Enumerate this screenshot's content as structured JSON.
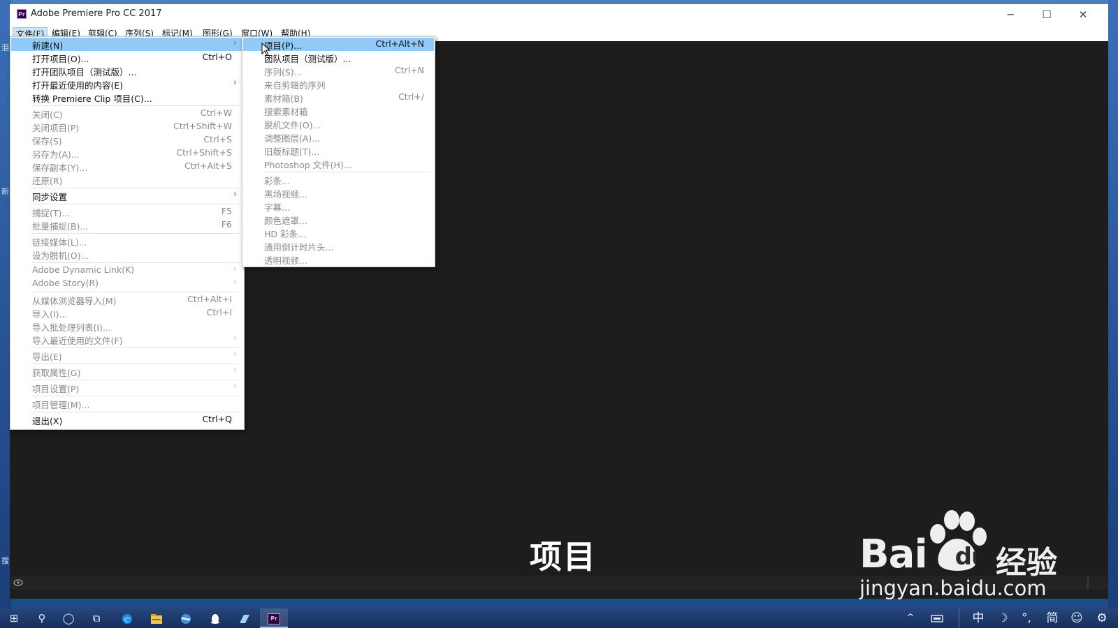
{
  "window": {
    "title": "Adobe Premiere Pro CC 2017",
    "app_icon_text": "Pr",
    "controls": {
      "minimize": "─",
      "maximize": "☐",
      "close": "✕"
    }
  },
  "menubar": [
    {
      "label": "文件(F)",
      "active": true
    },
    {
      "label": "编辑(E)"
    },
    {
      "label": "剪辑(C)"
    },
    {
      "label": "序列(S)"
    },
    {
      "label": "标记(M)"
    },
    {
      "label": "图形(G)"
    },
    {
      "label": "窗口(W)"
    },
    {
      "label": "帮助(H)"
    }
  ],
  "file_menu": [
    {
      "label": "新建(N)",
      "arrow": true,
      "enabled": true,
      "highlighted": true
    },
    {
      "label": "打开项目(O)...",
      "shortcut": "Ctrl+O",
      "enabled": true
    },
    {
      "label": "打开团队项目（测试版）...",
      "enabled": true
    },
    {
      "label": "打开最近使用的内容(E)",
      "arrow": true,
      "enabled": true
    },
    {
      "label": "转换 Premiere Clip 项目(C)...",
      "enabled": true
    },
    {
      "separator": true
    },
    {
      "label": "关闭(C)",
      "shortcut": "Ctrl+W",
      "enabled": false
    },
    {
      "label": "关闭项目(P)",
      "shortcut": "Ctrl+Shift+W",
      "enabled": false
    },
    {
      "label": "保存(S)",
      "shortcut": "Ctrl+S",
      "enabled": false
    },
    {
      "label": "另存为(A)...",
      "shortcut": "Ctrl+Shift+S",
      "enabled": false
    },
    {
      "label": "保存副本(Y)...",
      "shortcut": "Ctrl+Alt+S",
      "enabled": false
    },
    {
      "label": "还原(R)",
      "enabled": false
    },
    {
      "separator": true
    },
    {
      "label": "同步设置",
      "arrow": true,
      "enabled": true
    },
    {
      "separator": true
    },
    {
      "label": "捕捉(T)...",
      "shortcut": "F5",
      "enabled": false
    },
    {
      "label": "批量捕捉(B)...",
      "shortcut": "F6",
      "enabled": false
    },
    {
      "separator": true
    },
    {
      "label": "链接媒体(L)...",
      "enabled": false
    },
    {
      "label": "设为脱机(O)...",
      "enabled": false
    },
    {
      "separator": true
    },
    {
      "label": "Adobe Dynamic Link(K)",
      "arrow": true,
      "enabled": false
    },
    {
      "label": "Adobe Story(R)",
      "arrow": true,
      "enabled": false
    },
    {
      "separator": true
    },
    {
      "label": "从媒体浏览器导入(M)",
      "shortcut": "Ctrl+Alt+I",
      "enabled": false
    },
    {
      "label": "导入(I)...",
      "shortcut": "Ctrl+I",
      "enabled": false
    },
    {
      "label": "导入批处理列表(I)...",
      "enabled": false
    },
    {
      "label": "导入最近使用的文件(F)",
      "arrow": true,
      "enabled": false
    },
    {
      "separator": true
    },
    {
      "label": "导出(E)",
      "arrow": true,
      "enabled": false
    },
    {
      "separator": true
    },
    {
      "label": "获取属性(G)",
      "arrow": true,
      "enabled": false
    },
    {
      "separator": true
    },
    {
      "label": "项目设置(P)",
      "arrow": true,
      "enabled": false
    },
    {
      "separator": true
    },
    {
      "label": "项目管理(M)...",
      "enabled": false
    },
    {
      "separator": true
    },
    {
      "label": "退出(X)",
      "shortcut": "Ctrl+Q",
      "enabled": true
    }
  ],
  "new_submenu": [
    {
      "label": "项目(P)...",
      "shortcut": "Ctrl+Alt+N",
      "enabled": true,
      "highlighted": true
    },
    {
      "label": "团队项目（测试版）...",
      "enabled": true
    },
    {
      "label": "序列(S)...",
      "shortcut": "Ctrl+N",
      "enabled": false
    },
    {
      "label": "来自剪辑的序列",
      "enabled": false
    },
    {
      "label": "素材箱(B)",
      "shortcut": "Ctrl+/",
      "enabled": false
    },
    {
      "label": "搜索素材箱",
      "enabled": false
    },
    {
      "label": "脱机文件(O)...",
      "enabled": false
    },
    {
      "label": "调整图层(A)...",
      "enabled": false
    },
    {
      "label": "旧版标题(T)...",
      "enabled": false
    },
    {
      "label": "Photoshop 文件(H)...",
      "enabled": false
    },
    {
      "separator": true
    },
    {
      "label": "彩条...",
      "enabled": false
    },
    {
      "label": "黑场视频...",
      "enabled": false
    },
    {
      "label": "字幕...",
      "enabled": false
    },
    {
      "label": "颜色遮罩...",
      "enabled": false
    },
    {
      "label": "HD 彩条...",
      "enabled": false
    },
    {
      "label": "通用倒计时片头...",
      "enabled": false
    },
    {
      "label": "透明视频...",
      "enabled": false
    }
  ],
  "caption": "项目",
  "watermark": {
    "brand": "Bai",
    "brand_suffix": "du",
    "chinese": "经验",
    "url": "jingyan.baidu.com"
  },
  "desktop_fragments": [
    "泪",
    "新",
    "搜"
  ],
  "taskbar": {
    "start_icon": "⊞",
    "search_icon": "⚲",
    "cortana_icon": "◯",
    "taskview_icon": "⧉",
    "tray_lang": "中",
    "tray_moon": "☽",
    "tray_punct": "°,",
    "tray_simplified": "简",
    "tray_smile": "☺",
    "tray_gear": "⚙",
    "tray_up": "^"
  },
  "colors": {
    "highlight": "#91c9f7",
    "window_bg": "#1d1d1d",
    "taskbar": "#1b3665"
  }
}
